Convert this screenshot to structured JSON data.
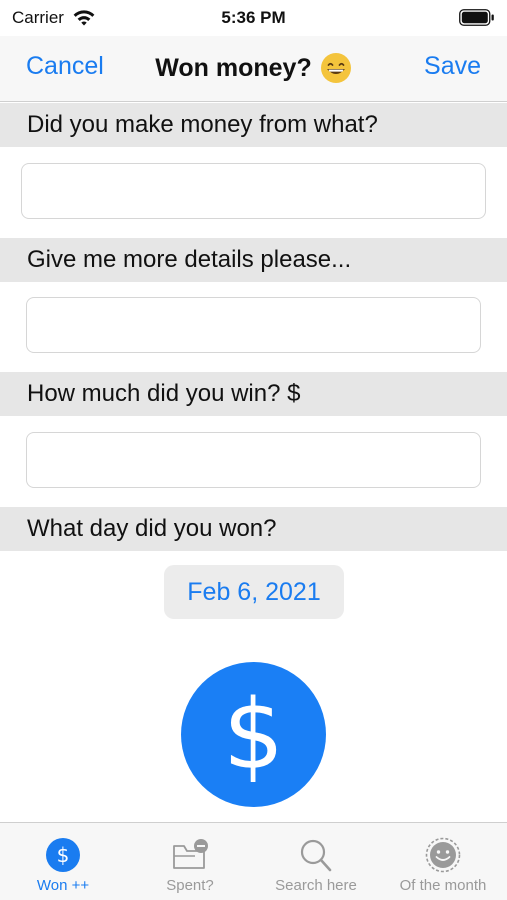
{
  "status_bar": {
    "carrier": "Carrier",
    "time": "5:36 PM",
    "icons": [
      "wifi-icon",
      "battery-icon"
    ]
  },
  "nav": {
    "cancel_label": "Cancel",
    "title": "Won money?",
    "title_icon": "grinning-face-icon",
    "save_label": "Save"
  },
  "form": {
    "source_header": "Did you make money from what?",
    "source_value": "",
    "details_header": "Give me more details please...",
    "details_value": "",
    "amount_header": "How much did you win? $",
    "amount_value": "",
    "date_header": "What day did you won?",
    "date_value": "Feb 6, 2021"
  },
  "action": {
    "icon": "dollar-icon",
    "glyph": "$"
  },
  "tabs": [
    {
      "label": "Won ++",
      "icon": "dollar-circle-icon",
      "active": true
    },
    {
      "label": "Spent?",
      "icon": "wallet-minus-icon",
      "active": false
    },
    {
      "label": "Search here",
      "icon": "search-icon",
      "active": false
    },
    {
      "label": "Of the month",
      "icon": "smiley-badge-icon",
      "active": false
    }
  ],
  "colors": {
    "accent": "#1a7cf0",
    "header_bg": "#e6e6e6",
    "bar_bg": "#f7f7f7",
    "inactive_tab": "#9a9a9a"
  }
}
